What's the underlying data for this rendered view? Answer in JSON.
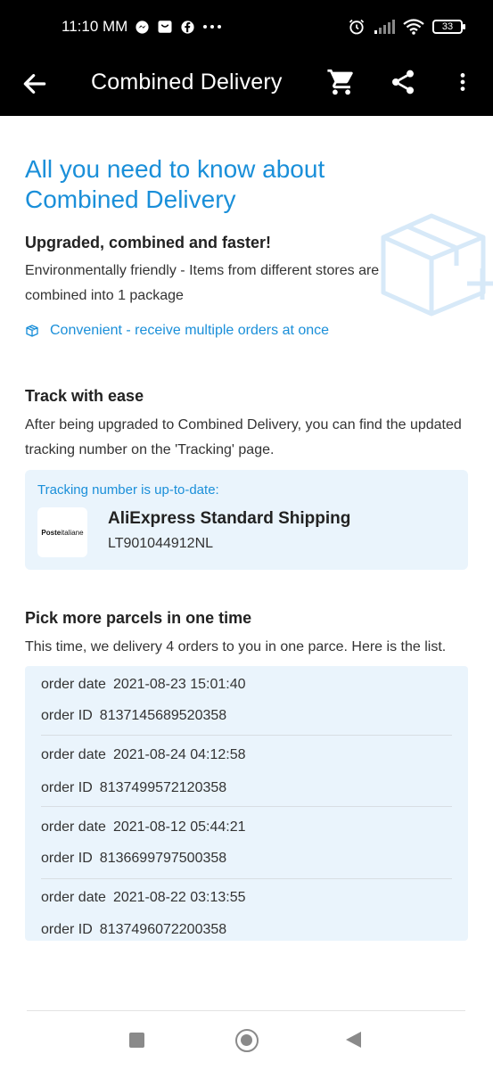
{
  "status_bar": {
    "time": "11:10 MM",
    "battery": "33",
    "left_icons": [
      "messenger-icon",
      "shop-icon",
      "facebook-icon",
      "more-dots-icon"
    ],
    "right_icons": [
      "alarm-icon",
      "signal-icon",
      "wifi-icon",
      "battery-icon"
    ]
  },
  "app_bar": {
    "title": "Combined Delivery",
    "icons": [
      "back-arrow-icon",
      "cart-icon",
      "share-icon",
      "more-vert-icon"
    ]
  },
  "hero": {
    "title": "All you need to know about Combined Delivery",
    "illustration": "package-plus-icon"
  },
  "section_upgraded": {
    "title": "Upgraded, combined and faster!",
    "text": "Environmentally friendly - Items from different stores are combined into 1 package",
    "convenient": "Convenient - receive multiple orders at once"
  },
  "section_track": {
    "title": "Track with ease",
    "text": "After being upgraded to Combined Delivery, you can find the updated tracking number on the 'Tracking' page.",
    "card": {
      "label": "Tracking number is up-to-date:",
      "logo_text_bold": "Poste",
      "logo_text": "italiane",
      "carrier": "AliExpress Standard Shipping",
      "tracking_number": "LT901044912NL"
    }
  },
  "section_pick": {
    "title": "Pick more parcels in one time",
    "text": "This time, we delivery 4 orders to you in one parce. Here is the list."
  },
  "orders": [
    {
      "date_label": "order date",
      "date": "2021-08-23 15:01:40",
      "id_label": "order ID",
      "id": "8137145689520358"
    },
    {
      "date_label": "order date",
      "date": "2021-08-24 04:12:58",
      "id_label": "order ID",
      "id": "8137499572120358"
    },
    {
      "date_label": "order date",
      "date": "2021-08-12 05:44:21",
      "id_label": "order ID",
      "id": "8136699797500358"
    },
    {
      "date_label": "order date",
      "date": "2021-08-22 03:13:55",
      "id_label": "order ID",
      "id": "8137496072200358"
    }
  ],
  "colors": {
    "accent": "#1a8fd9",
    "card_bg": "#eaf4fc",
    "app_bar_bg": "#000000"
  }
}
